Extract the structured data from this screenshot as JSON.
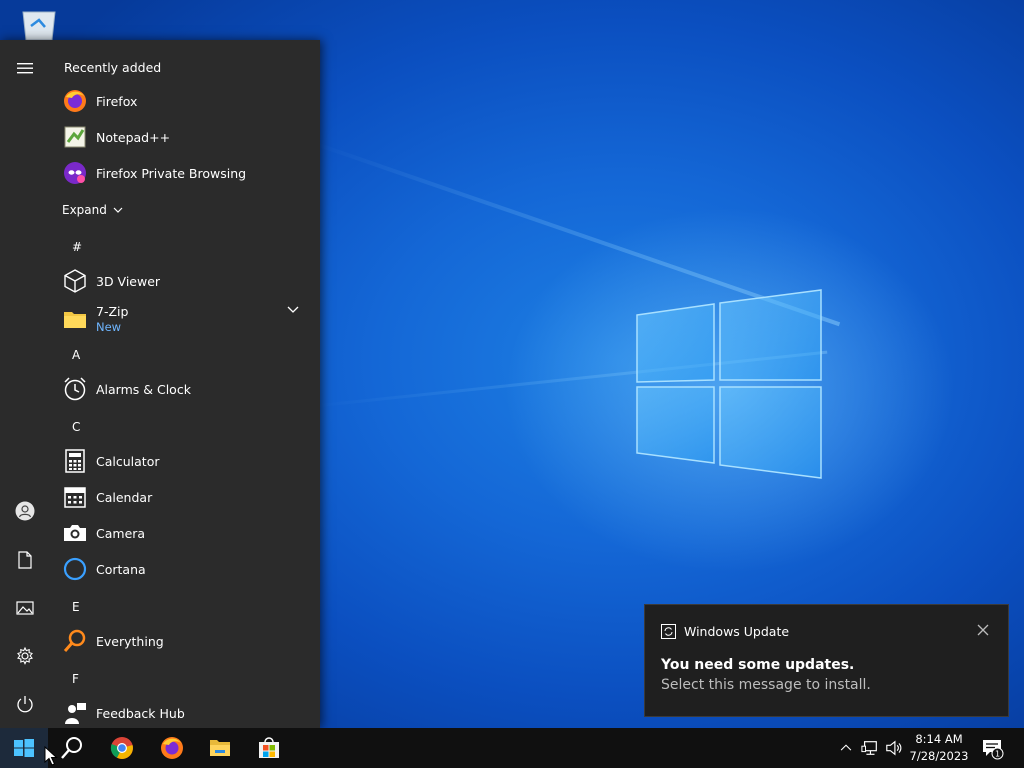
{
  "start_menu": {
    "recently_added_title": "Recently added",
    "recent_apps": [
      {
        "label": "Firefox",
        "icon": "firefox-icon"
      },
      {
        "label": "Notepad++",
        "icon": "notepadpp-icon"
      },
      {
        "label": "Firefox Private Browsing",
        "icon": "firefox-private-icon"
      }
    ],
    "expand_label": "Expand",
    "groups": [
      {
        "letter": "#",
        "apps": [
          {
            "label": "3D Viewer",
            "icon": "3d-viewer-icon"
          },
          {
            "label": "7-Zip",
            "sub": "New",
            "icon": "folder-icon"
          }
        ]
      },
      {
        "letter": "A",
        "apps": [
          {
            "label": "Alarms & Clock",
            "icon": "alarm-clock-icon"
          }
        ]
      },
      {
        "letter": "C",
        "apps": [
          {
            "label": "Calculator",
            "icon": "calculator-icon"
          },
          {
            "label": "Calendar",
            "icon": "calendar-icon"
          },
          {
            "label": "Camera",
            "icon": "camera-icon"
          },
          {
            "label": "Cortana",
            "icon": "cortana-icon"
          }
        ]
      },
      {
        "letter": "E",
        "apps": [
          {
            "label": "Everything",
            "icon": "everything-search-icon"
          }
        ]
      },
      {
        "letter": "F",
        "apps": [
          {
            "label": "Feedback Hub",
            "icon": "feedback-hub-icon"
          }
        ]
      }
    ],
    "rail_icons": [
      "hamburger-icon",
      "user-icon",
      "document-icon",
      "pictures-icon",
      "gear-icon",
      "power-icon"
    ]
  },
  "notification": {
    "app_name": "Windows Update",
    "title": "You need some updates.",
    "body": "Select this message to install."
  },
  "taskbar": {
    "pinned": [
      "windows-start-icon",
      "search-icon",
      "chrome-icon",
      "firefox-icon",
      "file-explorer-icon",
      "microsoft-store-icon"
    ],
    "tray": [
      "chevron-up-icon",
      "network-icon",
      "volume-icon"
    ],
    "time": "8:14 AM",
    "date": "7/28/2023",
    "notification_count": "1"
  },
  "colors": {
    "accent": "#0078d7",
    "start_bg": "#2b2b2b",
    "taskbar_bg": "#101010",
    "new_badge": "#6fb6ff"
  }
}
